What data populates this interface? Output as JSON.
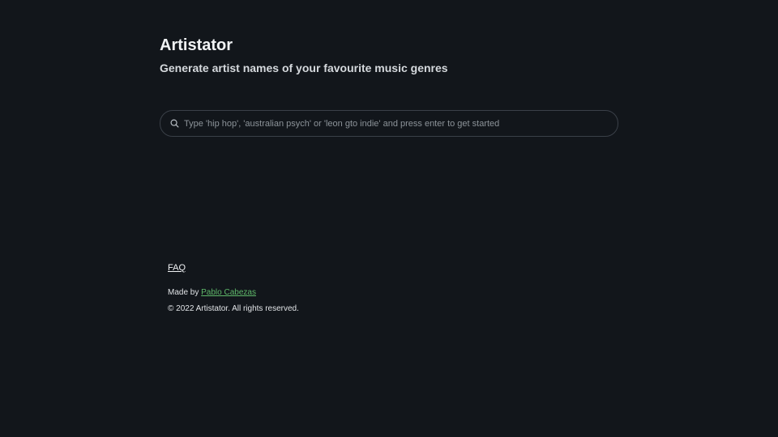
{
  "header": {
    "title": "Artistator",
    "subtitle": "Generate artist names of your favourite music genres"
  },
  "search": {
    "placeholder": "Type 'hip hop', 'australian psych' or 'leon gto indie' and press enter to get started",
    "value": "",
    "icon": "search-icon"
  },
  "footer": {
    "faq_label": "FAQ",
    "made_by_prefix": "Made by",
    "author_name": "Pablo Cabezas",
    "copyright": "© 2022 Artistator. All rights reserved."
  },
  "colors": {
    "background": "#12161b",
    "link_accent": "#5fb86a"
  }
}
